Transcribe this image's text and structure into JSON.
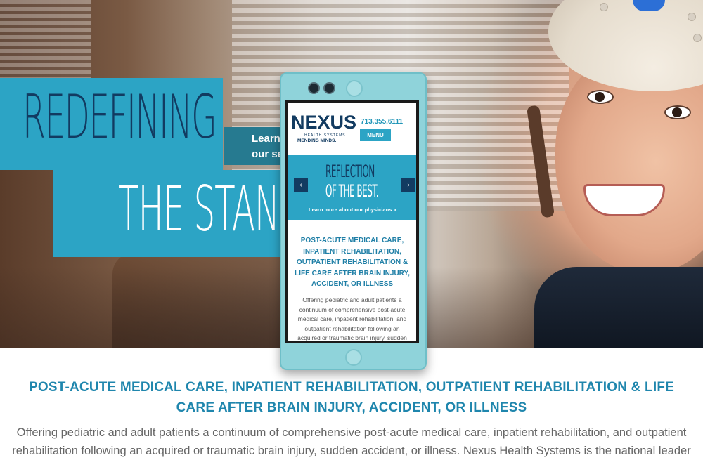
{
  "hero": {
    "headline_line1": "REDEFINING",
    "headline_line2": "THE STANDA",
    "learn_line1": "Learn",
    "learn_line2": "our se"
  },
  "phone": {
    "logo_word": "NEXUS",
    "logo_sub": "HEALTH SYSTEMS",
    "logo_tagline": "MENDING MINDS.",
    "phone_number": "713.355.6111",
    "menu_label": "MENU",
    "banner_line1": "REFLECTION",
    "banner_line2": "OF THE BEST.",
    "banner_link": "Learn more about our physicians »",
    "prev_arrow": "‹",
    "next_arrow": "›",
    "heading": "POST-ACUTE MEDICAL CARE, INPATIENT REHABILITATION, OUTPATIENT REHABILITATION & LIFE CARE AFTER BRAIN INJURY, ACCIDENT, OR ILLNESS",
    "body": "Offering pediatric and adult patients a continuum of comprehensive post-acute medical care, inpatient rehabilitation, and outpatient rehabilitation following an acquired or traumatic brain injury, sudden"
  },
  "content": {
    "heading_line1": "POST-ACUTE MEDICAL CARE, INPATIENT REHABILITATION, OUTPATIENT REHABILITATION & LIFE",
    "heading_line2": "CARE AFTER BRAIN INJURY, ACCIDENT, OR ILLNESS",
    "body_line1": "Offering pediatric and adult patients a continuum of comprehensive post-acute medical care, inpatient rehabilitation, and outpatient",
    "body_line2": "rehabilitation following an acquired or traumatic brain injury, sudden accident, or illness. Nexus Health Systems is the national leader"
  },
  "colors": {
    "accent_blue": "#2ca4c5",
    "navy": "#123b61",
    "heading_blue": "#1f86ad",
    "phone_body": "#8fd3da"
  }
}
